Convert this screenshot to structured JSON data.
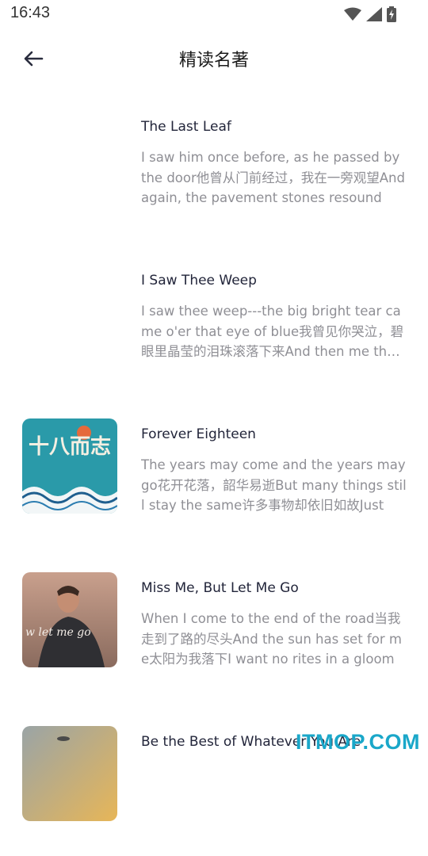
{
  "status_bar": {
    "time": "16:43"
  },
  "header": {
    "title": "精读名著"
  },
  "articles": [
    {
      "title": "The Last Leaf",
      "excerpt": "I saw him once before, as he passed by the door他曾从门前经过，我在一旁观望And again, the pavement stones resound",
      "cover": "none"
    },
    {
      "title": "I Saw Thee Weep",
      "excerpt": "I saw thee weep---the big bright tear came o'er that eye of blue我曾见你哭泣，碧眼里晶莹的泪珠滚落下来And then me thought",
      "cover": "none"
    },
    {
      "title": "Forever Eighteen",
      "excerpt": "The years may come and the years may go花开花落，韶华易逝But many things still stay the same许多事物却依旧如故Just",
      "cover": "teal-wave-illustration",
      "cover_text": "十八而志"
    },
    {
      "title": "Miss Me, But Let Me Go",
      "excerpt": "When I come to the end of the road当我走到了路的尽头And the sun has set for me太阳为我落下I want no rites in a gloom",
      "cover": "man-photo",
      "cover_text": "w let me go"
    },
    {
      "title": "Be the Best of Whatever You Are",
      "excerpt": "",
      "cover": "sunset-sky"
    }
  ],
  "watermark": "ITMOP.COM",
  "colors": {
    "title": "#22253a",
    "excerpt": "#8f8f95",
    "watermark": "#1aa7c9"
  }
}
